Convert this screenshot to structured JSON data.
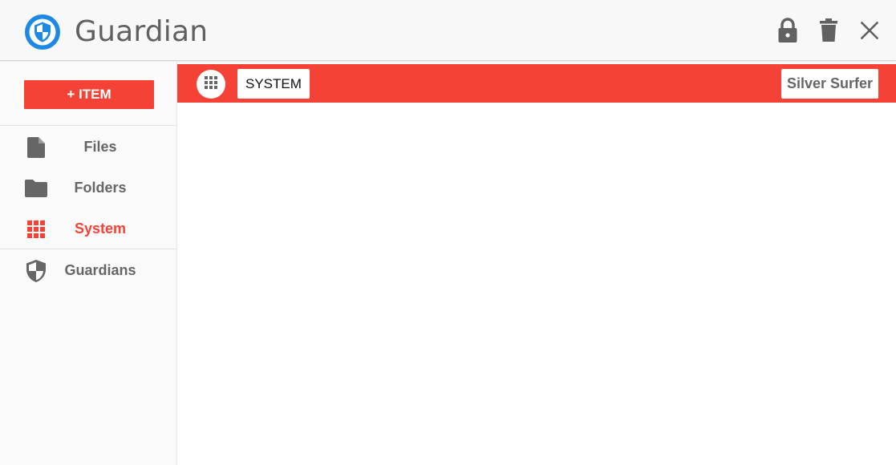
{
  "app": {
    "title": "Guardian",
    "logo_icon": "shield-logo-icon",
    "accent_color": "#f44336",
    "logo_color": "#1e88e5"
  },
  "titlebar": {
    "actions": [
      {
        "name": "lock",
        "icon": "lock-icon"
      },
      {
        "name": "delete",
        "icon": "trash-icon"
      },
      {
        "name": "close",
        "icon": "close-icon"
      }
    ]
  },
  "sidebar": {
    "add_button_label": "+ ITEM",
    "items": [
      {
        "label": "Files",
        "icon": "file-icon",
        "active": false
      },
      {
        "label": "Folders",
        "icon": "folder-icon",
        "active": false
      },
      {
        "label": "System",
        "icon": "grid-icon",
        "active": true
      },
      {
        "label": "Guardians",
        "icon": "shield-icon",
        "active": false
      }
    ]
  },
  "toolbar": {
    "grid_icon": "apps-grid-icon",
    "breadcrumb": "SYSTEM",
    "user": "Silver Surfer"
  }
}
